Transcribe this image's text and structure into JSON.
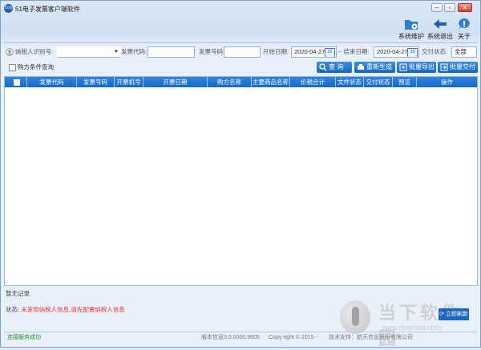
{
  "window": {
    "title": "51电子发票客户端软件",
    "logo_text": "51fp"
  },
  "toolbar": {
    "maintenance_label": "系统维护",
    "exit_label": "系统退出",
    "about_label": "关于"
  },
  "filters": {
    "taxpayer_label": "纳税人识别号:",
    "taxpayer_value": "",
    "invoice_code_label": "发票代码:",
    "invoice_code_value": "",
    "invoice_no_label": "发票号码:",
    "invoice_no_value": "",
    "start_date_label": "开始日期:",
    "start_date_value": "2020-04-27",
    "end_date_label": "~ 结束日期:",
    "end_date_value": "2020-04-27",
    "calendar_text": "15",
    "delivery_status_label": "交付状态:",
    "delivery_status_value": "全部",
    "buyer_query_label": "购方条件查询"
  },
  "actions": {
    "search_label": "查 询",
    "regenerate_label": "重新生成",
    "batch_export_label": "批量导出",
    "batch_deliver_label": "批量交付"
  },
  "table": {
    "columns": [
      "发票代码",
      "发票号码",
      "开票机号",
      "开票日期",
      "购方名称",
      "主要商品名称",
      "价税合计",
      "文件状态",
      "交付状态",
      "预览",
      "操作"
    ],
    "rows": []
  },
  "messages": {
    "empty": "暂无记录",
    "status_label": "状态:",
    "status_text": "未发现纳税人信息,请先配置纳税人信息",
    "refresh_label": "立即刷新"
  },
  "footer": {
    "connection": "连接服务成功",
    "version": "版本信息3.0.0000.9605",
    "copyright": "Copy right © 2015 -",
    "support": "技术支持：航天信息股份有限公司"
  },
  "watermark": {
    "text": "当下软件园",
    "url": "www.downxia.com"
  }
}
